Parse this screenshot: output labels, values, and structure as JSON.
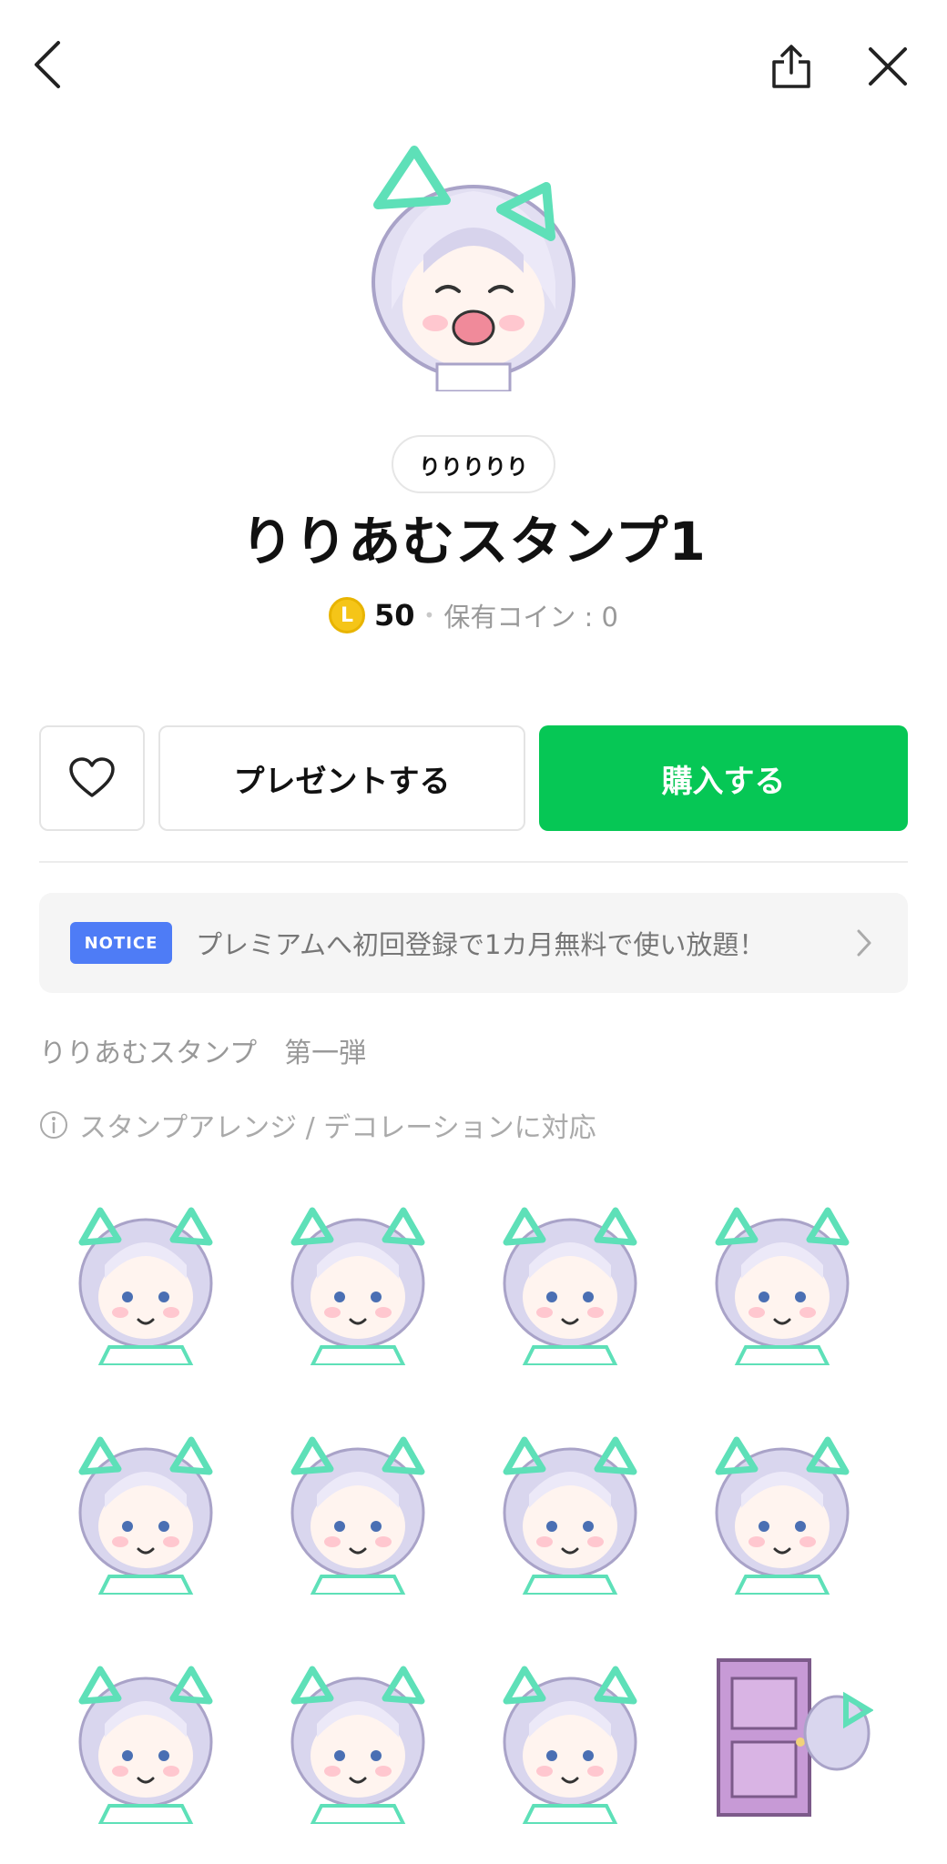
{
  "header": {
    "back_icon": "chevron-left-icon",
    "share_icon": "share-icon",
    "close_icon": "close-icon"
  },
  "package": {
    "author": "りりりりり",
    "title": "りりあむスタンプ1",
    "coin_symbol": "L",
    "price": "50",
    "separator": "•",
    "owned_coins": "保有コイン : 0"
  },
  "actions": {
    "wish_icon": "heart-icon",
    "gift_label": "プレゼントする",
    "buy_label": "購入する"
  },
  "notice": {
    "badge": "NOTICE",
    "text": "プレミアムへ初回登録で1カ月無料で使い放題！"
  },
  "description": "りりあむスタンプ　第一弾",
  "arrange_note": "スタンプアレンジ / デコレーションに対応",
  "colors": {
    "buy_green": "#06c755",
    "notice_blue": "#4e7cf6",
    "coin_gold": "#f5c518",
    "mint": "#5ee0b8",
    "hair_lavender": "#d9d6ee"
  },
  "stickers_count_visible": 12
}
